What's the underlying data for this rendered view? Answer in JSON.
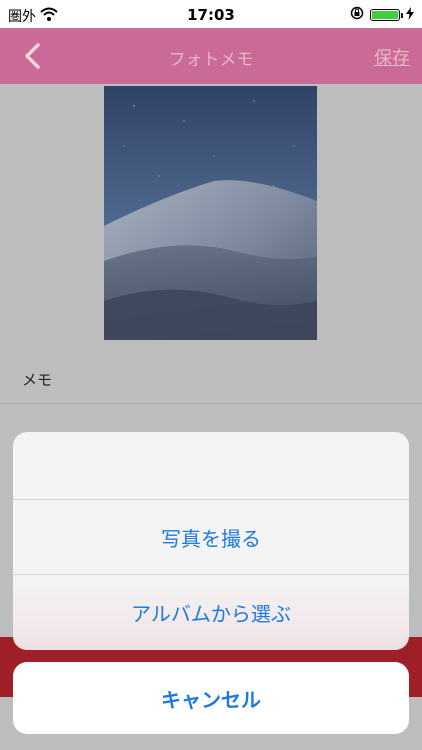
{
  "status_bar": {
    "carrier": "圏外",
    "time": "17:03",
    "battery_level": 1.0,
    "icons": [
      "wifi-icon",
      "rotation-lock-icon",
      "battery-icon",
      "charging-icon"
    ]
  },
  "nav": {
    "title": "フォトメモ",
    "save_label": "保存",
    "back_icon": "chevron-left-icon"
  },
  "content": {
    "memo_label": "メモ"
  },
  "action_sheet": {
    "items": [
      {
        "label": "写真を撮る"
      },
      {
        "label": "アルバムから選ぶ"
      }
    ],
    "cancel_label": "キャンセル"
  },
  "colors": {
    "accent": "#1f7ae0",
    "nav_bg": "#ca6b97",
    "battery": "#3fcf3a"
  }
}
